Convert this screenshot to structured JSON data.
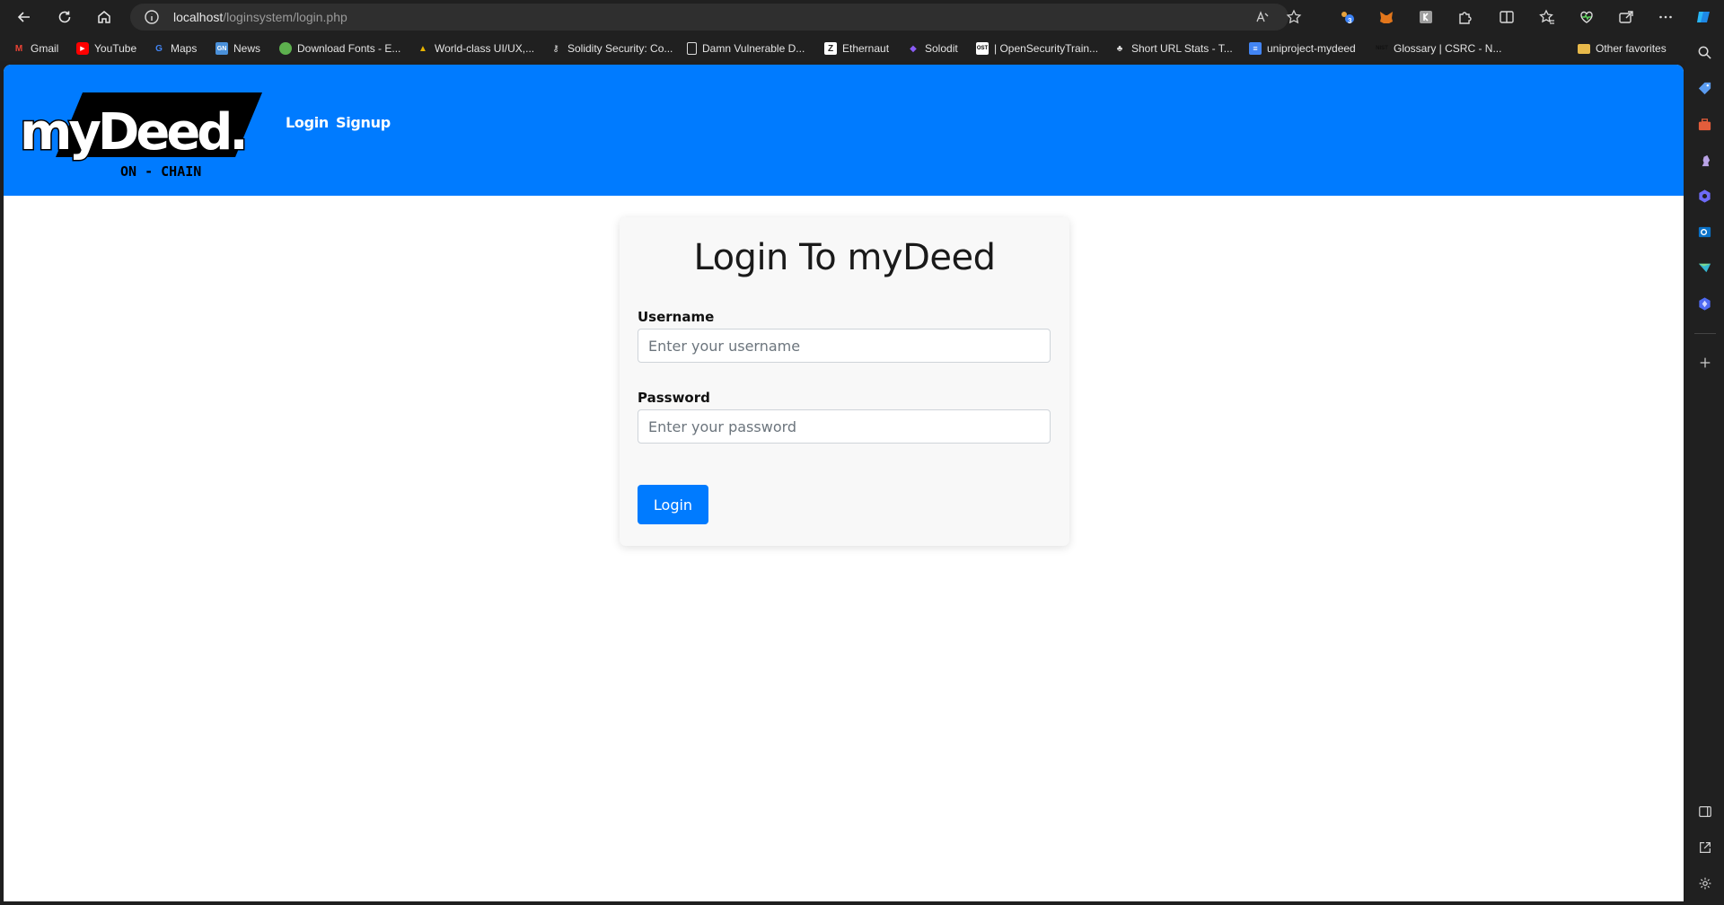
{
  "browser": {
    "url_host": "localhost",
    "url_path": "/loginsystem/login.php",
    "bookmarks": [
      {
        "label": "Gmail",
        "icon": "gmail-icon",
        "color": "#ea4335"
      },
      {
        "label": "YouTube",
        "icon": "youtube-icon",
        "color": "#ff0000"
      },
      {
        "label": "Maps",
        "icon": "google-icon",
        "color": "#4285f4"
      },
      {
        "label": "News",
        "icon": "news-icon",
        "color": "#4a90d9"
      },
      {
        "label": "Download Fonts - E...",
        "icon": "leaf-icon",
        "color": "#5db04e"
      },
      {
        "label": "World-class UI/UX,...",
        "icon": "crown-icon",
        "color": "#e8b400"
      },
      {
        "label": "Solidity Security: Co...",
        "icon": "key-icon",
        "color": "#e0e0e0"
      },
      {
        "label": "Damn Vulnerable D...",
        "icon": "page-icon",
        "color": "#e0e0e0"
      },
      {
        "label": "Ethernaut",
        "icon": "ethernaut-icon",
        "color": "#ffffff"
      },
      {
        "label": "Solodit",
        "icon": "solodit-icon",
        "color": "#8b5cf6"
      },
      {
        "label": "| OpenSecurityTrain...",
        "icon": "ost-icon",
        "color": "#ffffff"
      },
      {
        "label": "Short URL Stats - T...",
        "icon": "tree-icon",
        "color": "#e0e0e0"
      },
      {
        "label": "uniproject-mydeed",
        "icon": "docs-icon",
        "color": "#4285f4"
      },
      {
        "label": "Glossary | CSRC - N...",
        "icon": "nist-icon",
        "color": "#111111"
      }
    ],
    "other_favorites": "Other favorites",
    "extension_badge": "3"
  },
  "site": {
    "logo_text_top": "myDeed.",
    "logo_text_bottom": "ON - CHAIN",
    "nav": {
      "login": "Login",
      "signup": "Signup"
    },
    "accent": "#007bff"
  },
  "login": {
    "title": "Login To myDeed",
    "username_label": "Username",
    "username_placeholder": "Enter your username",
    "username_value": "",
    "password_label": "Password",
    "password_placeholder": "Enter your password",
    "password_value": "",
    "submit_label": "Login"
  }
}
